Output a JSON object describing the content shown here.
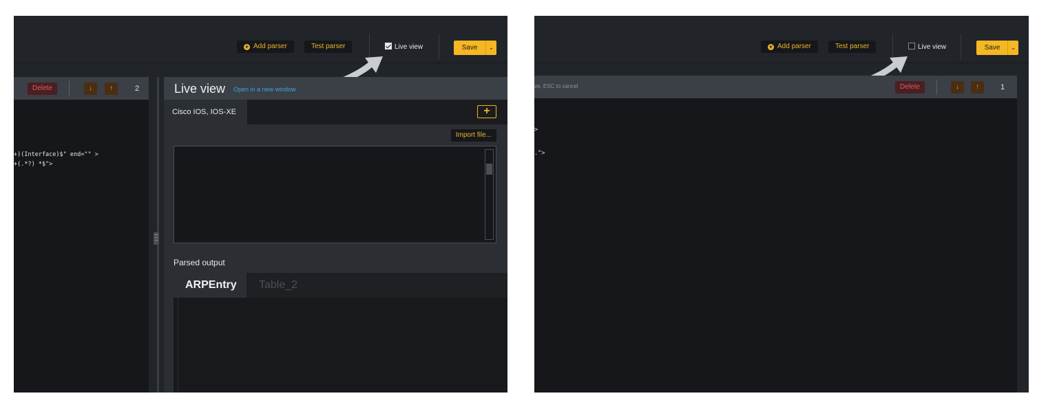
{
  "left": {
    "toolbar": {
      "add_parser_label": "Add parser",
      "test_parser_label": "Test parser",
      "live_view_label": "Live view",
      "live_view_checked": true,
      "save_label": "Save",
      "save_caret": "⌄"
    },
    "editor": {
      "delete_label": "Delete",
      "down_label": "↓",
      "up_label": "↑",
      "count": "2",
      "code_lines": [
        "+)(Interface)$\" end=\"\" >",
        "+(.*?) *$\">"
      ]
    },
    "live_view": {
      "title": "Live view",
      "open_link": "Open in a new window",
      "tab_label": "Cisco IOS, IOS-XE",
      "add_tab_label": "+",
      "import_label": "Import file...",
      "parsed_output_label": "Parsed output",
      "output_tabs": [
        "ARPEntry",
        "Table_2"
      ]
    }
  },
  "right": {
    "toolbar": {
      "add_parser_label": "Add parser",
      "test_parser_label": "Test parser",
      "live_view_label": "Live view",
      "live_view_checked": false,
      "save_label": "Save",
      "save_caret": "⌄"
    },
    "editor": {
      "hint": "ve, ESC to cancel",
      "delete_label": "Delete",
      "down_label": "↓",
      "up_label": "↑",
      "count": "1",
      "code_lines": [
        ">",
        ".\">"
      ]
    }
  },
  "colors": {
    "background": "#212429",
    "accent": "#f0b429",
    "save_button": "#f5b823",
    "delete": "#e05a5a",
    "link": "#3aa6e0"
  }
}
